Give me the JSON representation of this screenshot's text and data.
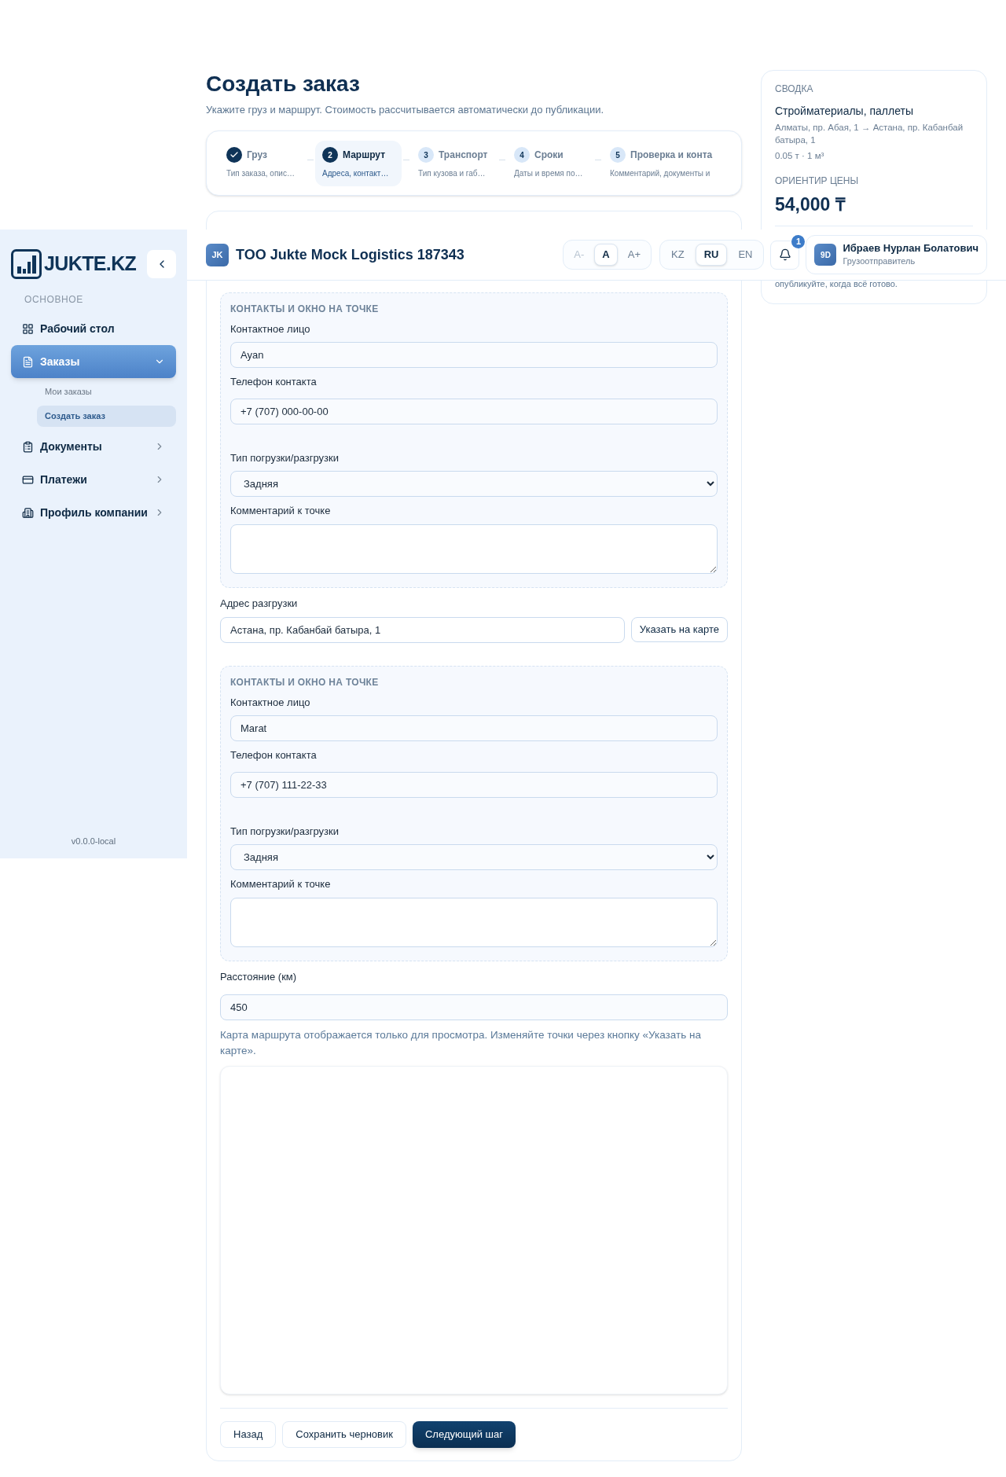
{
  "page": {
    "title": "Создать заказ",
    "subtitle": "Укажите груз и маршрут. Стоимость рассчитывается автоматически до публикации."
  },
  "steps": [
    {
      "title": "Груз",
      "subtitle": "Тип заказа, опис…",
      "done": true,
      "selected": false
    },
    {
      "number": "2",
      "title": "Маршрут",
      "subtitle": "Адреса, контакт…",
      "done": false,
      "selected": true
    },
    {
      "number": "3",
      "title": "Транспорт",
      "subtitle": "Тип кузова и габ…",
      "done": false,
      "selected": false
    },
    {
      "number": "4",
      "title": "Сроки",
      "subtitle": "Даты и время по…",
      "done": false,
      "selected": false
    },
    {
      "number": "5",
      "title": "Проверка и конта",
      "subtitle": "Комментарий, документы и",
      "done": false,
      "selected": false
    }
  ],
  "points": [
    {
      "heading": "КОНТАКТЫ И ОКНО НА ТОЧКЕ",
      "contact_label": "Контактное лицо",
      "contact": "Ayan",
      "phone_label": "Телефон контакта",
      "phone": "+7 (707) 000-00-00",
      "type_label": "Тип погрузки/разгрузки",
      "type": "Задняя",
      "comment_label": "Комментарий к точке"
    },
    {
      "address_label": "Адрес разгрузки",
      "address": "Астана, пр. Кабанбай батыра, 1",
      "map_button": "Указать на карте",
      "heading": "КОНТАКТЫ И ОКНО НА ТОЧКЕ",
      "contact_label": "Контактное лицо",
      "contact": "Marat",
      "phone_label": "Телефон контакта",
      "phone": "+7 (707) 111-22-33",
      "type_label": "Тип погрузки/разгрузки",
      "type": "Задняя",
      "comment_label": "Комментарий к точке"
    }
  ],
  "distance": {
    "label": "Расстояние (км)",
    "value": "450",
    "hint": "Карта маршрута отображается только для просмотра. Изменяйте точки через кнопку «Указать на карте»."
  },
  "actions": [
    {
      "label": "Назад",
      "kind": "secondary"
    },
    {
      "label": "Сохранить черновик",
      "kind": "secondary"
    },
    {
      "label": "Следующий шаг",
      "kind": "primary"
    }
  ],
  "summary": {
    "heading": "СВОДКА",
    "cargo": "Стройматериалы, паллеты",
    "route": "Алматы, пр. Абая, 1 → Астана, пр. Кабанбай батыра, 1",
    "size": "0.05 т · 1 м³",
    "price_label": "ОРИЕНТИР ЦЕНЫ",
    "price": "54,000 ₸",
    "note": "опубликуйте, когда всё готово."
  },
  "header": {
    "avatar": "JK",
    "company": "TOO Jukte Mock Logistics 187343",
    "font_sizes": [
      {
        "label": "A-",
        "selected": false,
        "disabled": true
      },
      {
        "label": "A",
        "selected": true,
        "disabled": false
      },
      {
        "label": "A+",
        "selected": false,
        "disabled": false
      }
    ],
    "languages": [
      {
        "label": "KZ",
        "selected": false
      },
      {
        "label": "RU",
        "selected": true
      },
      {
        "label": "EN",
        "selected": false
      }
    ],
    "notifications": "1",
    "user": {
      "avatar": "9D",
      "name": "Ибраев Нурлан Болатович",
      "role": "Грузоотправитель"
    }
  },
  "sidebar": {
    "logo": "JUKTE.KZ",
    "section": "ОСНОВНОЕ",
    "version": "v0.0.0-local",
    "items": [
      {
        "label": "Рабочий стол",
        "selected": false
      },
      {
        "label": "Заказы",
        "selected": true,
        "expanded": true,
        "children": [
          {
            "label": "Мои заказы",
            "selected": false
          },
          {
            "label": "Создать заказ",
            "selected": true
          }
        ]
      },
      {
        "label": "Документы",
        "selected": false,
        "expanded": false
      },
      {
        "label": "Платежи",
        "selected": false,
        "expanded": false
      },
      {
        "label": "Профиль компании",
        "selected": false,
        "expanded": false
      }
    ]
  }
}
